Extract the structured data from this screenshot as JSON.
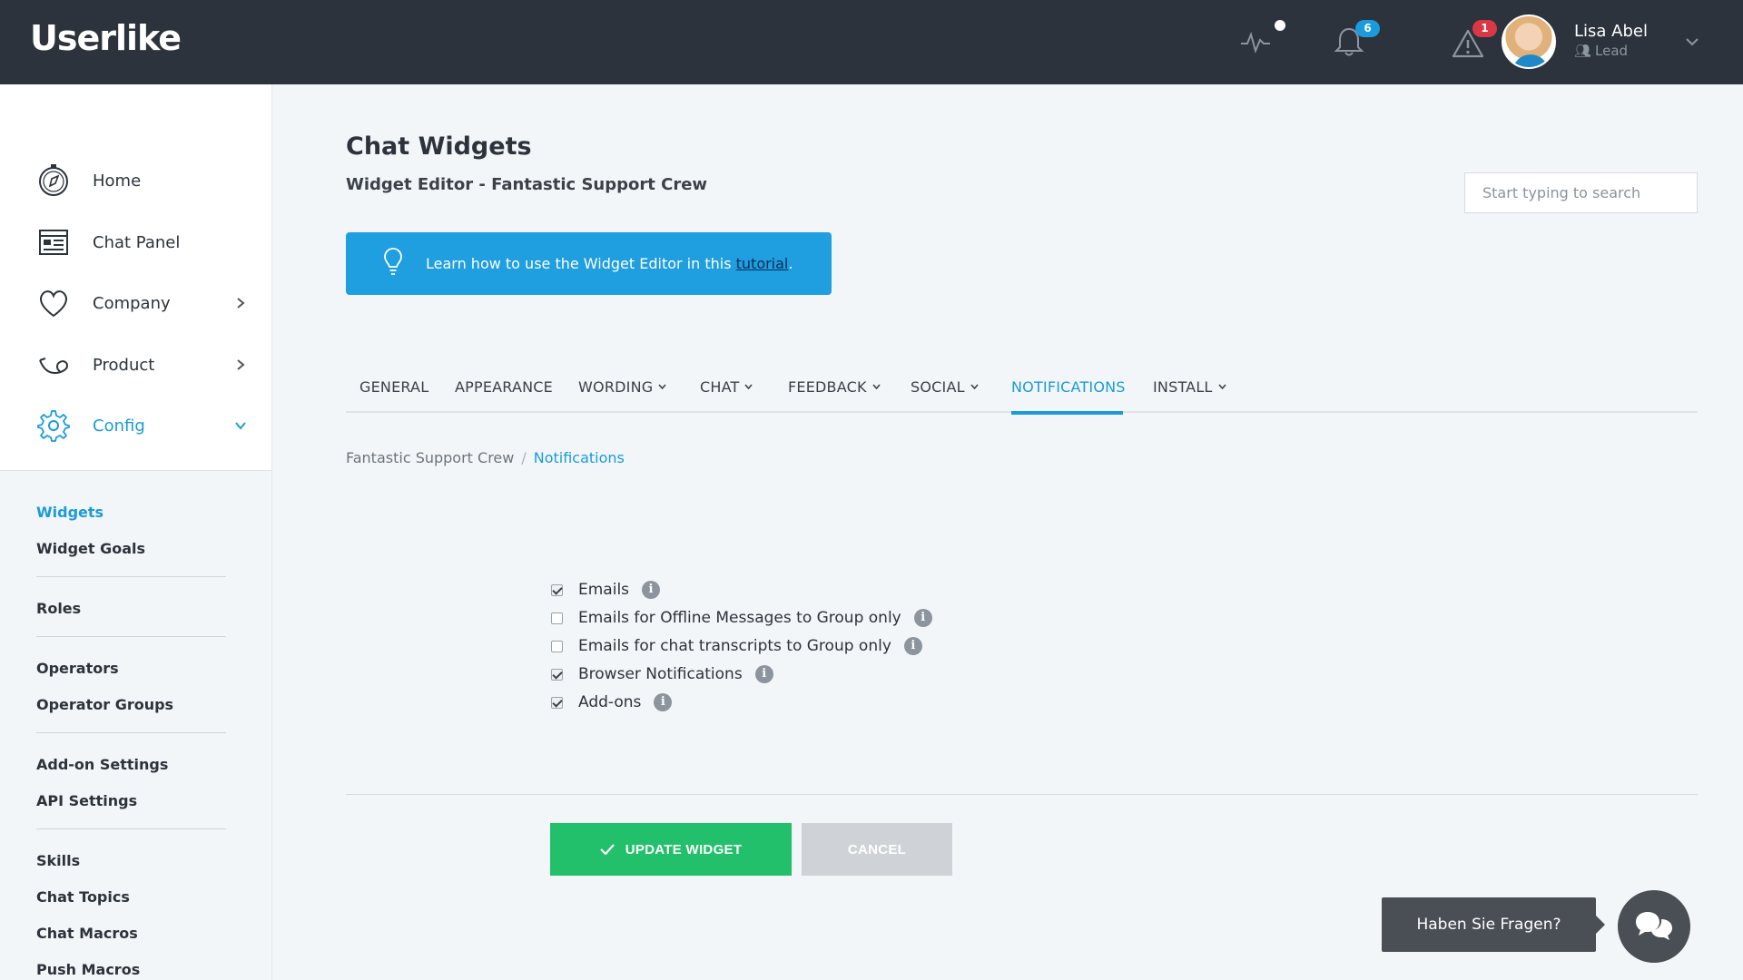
{
  "header": {
    "logo_text": "Userlike",
    "notifications_count": "6",
    "alerts_count": "1",
    "user": {
      "name": "Lisa Abel",
      "role": "Lead"
    }
  },
  "sidebar": {
    "items": [
      {
        "label": "Home",
        "icon": "compass-icon"
      },
      {
        "label": "Chat Panel",
        "icon": "chat-panel-icon"
      },
      {
        "label": "Company",
        "icon": "heart-icon"
      },
      {
        "label": "Product",
        "icon": "product-icon"
      },
      {
        "label": "Config",
        "icon": "gear-icon",
        "active": true
      }
    ],
    "subitems": [
      "Widgets",
      "Widget Goals",
      "Roles",
      "Operators",
      "Operator Groups",
      "Add-on Settings",
      "API Settings",
      "Skills",
      "Chat Topics",
      "Chat Macros",
      "Push Macros"
    ],
    "active_subitem": "Widgets"
  },
  "main": {
    "title": "Chat Widgets",
    "subtitle": "Widget Editor - Fantastic Support Crew",
    "search_placeholder": "Start typing to search",
    "banner": {
      "text": "Learn how to use the Widget Editor in this ",
      "link": "tutorial",
      "end": "."
    },
    "tabs": [
      {
        "label": "GENERAL",
        "dropdown": false
      },
      {
        "label": "APPEARANCE",
        "dropdown": false
      },
      {
        "label": "WORDING",
        "dropdown": true
      },
      {
        "label": "CHAT",
        "dropdown": true
      },
      {
        "label": "FEEDBACK",
        "dropdown": true
      },
      {
        "label": "SOCIAL",
        "dropdown": true
      },
      {
        "label": "NOTIFICATIONS",
        "dropdown": false,
        "active": true
      },
      {
        "label": "INSTALL",
        "dropdown": true
      }
    ],
    "breadcrumb": {
      "parent": "Fantastic Support Crew",
      "separator": "/",
      "current": "Notifications"
    },
    "options": [
      {
        "label": "Emails",
        "checked": true
      },
      {
        "label": "Emails for Offline Messages to Group only",
        "checked": false
      },
      {
        "label": "Emails for chat transcripts to Group only",
        "checked": false
      },
      {
        "label": "Browser Notifications",
        "checked": true
      },
      {
        "label": "Add-ons",
        "checked": true
      }
    ],
    "update_label": "UPDATE WIDGET",
    "cancel_label": "CANCEL"
  },
  "chat": {
    "prompt": "Haben Sie Fragen?"
  },
  "colors": {
    "accent": "#1a9bdb",
    "topbar": "#2c333c",
    "success": "#22c06a",
    "danger": "#d93947"
  }
}
